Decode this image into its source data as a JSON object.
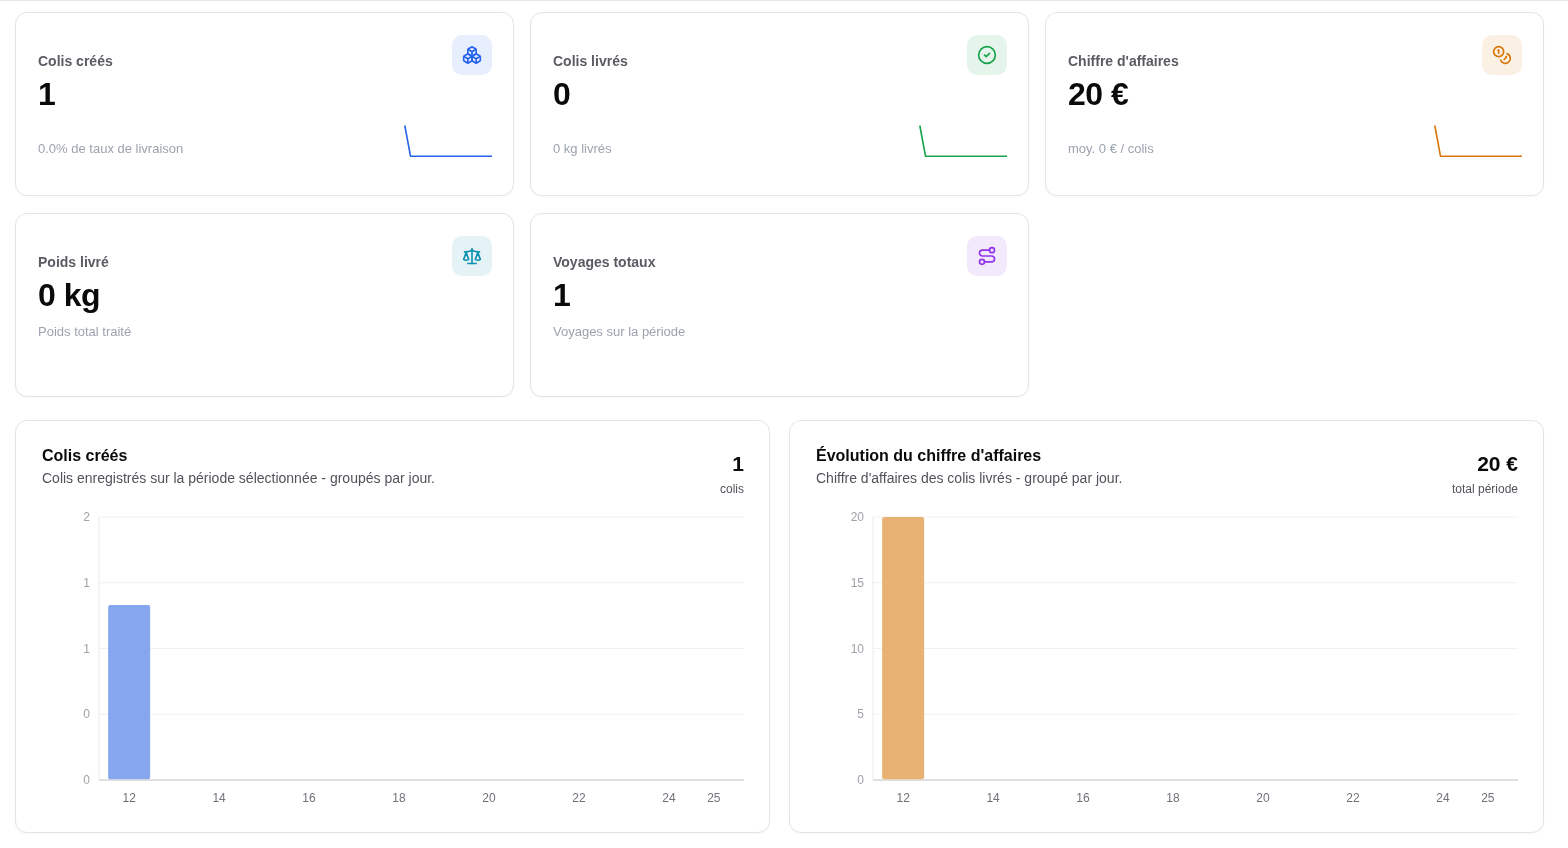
{
  "stat_cards": [
    {
      "title": "Colis créés",
      "value": "1",
      "caption": "0.0% de taux de livraison",
      "color": "#2563eb",
      "sparkline": true
    },
    {
      "title": "Colis livrés",
      "value": "0",
      "caption": "0 kg livrés",
      "color": "#16a34a",
      "sparkline": true
    },
    {
      "title": "Chiffre d'affaires",
      "value": "20 €",
      "caption": "moy. 0 € / colis",
      "color": "#d97706",
      "sparkline": true
    },
    {
      "title": "Poids livré",
      "value": "0 kg",
      "caption": "Poids total traité",
      "color": "#0e91b0",
      "sparkline": false
    },
    {
      "title": "Voyages totaux",
      "value": "1",
      "caption": "Voyages sur la période",
      "color": "#9333ea",
      "sparkline": false
    }
  ],
  "charts": [
    {
      "title": "Colis créés",
      "subtitle": "Colis enregistrés sur la période sélectionnée - groupés par jour.",
      "total": "1",
      "total_label": "colis",
      "chart_data": {
        "type": "bar",
        "x": [
          12
        ],
        "series": [
          {
            "color": "#86a6f0",
            "values": [
              1.33
            ]
          }
        ],
        "xlim": [
          11.33,
          25.67
        ],
        "ylim": [
          0,
          2
        ],
        "yticks": [
          {
            "value": 0,
            "label": "0"
          },
          {
            "value": 0.5,
            "label": "0"
          },
          {
            "value": 1,
            "label": "1"
          },
          {
            "value": 1.5,
            "label": "1"
          },
          {
            "value": 2,
            "label": "2"
          }
        ],
        "xticks": [
          12,
          14,
          16,
          18,
          20,
          22,
          24,
          25
        ],
        "grid": true
      }
    },
    {
      "title": "Évolution du chiffre d'affaires",
      "subtitle": "Chiffre d'affaires des colis livrés - groupé par jour.",
      "total": "20 €",
      "total_label": "total période",
      "chart_data": {
        "type": "bar",
        "x": [
          12
        ],
        "series": [
          {
            "color": "#e8b272",
            "values": [
              20
            ]
          }
        ],
        "xlim": [
          11.33,
          25.67
        ],
        "ylim": [
          0,
          20
        ],
        "yticks": [
          0,
          5,
          10,
          15,
          20
        ],
        "xticks": [
          12,
          14,
          16,
          18,
          20,
          22,
          24,
          25
        ],
        "grid": true
      }
    }
  ]
}
